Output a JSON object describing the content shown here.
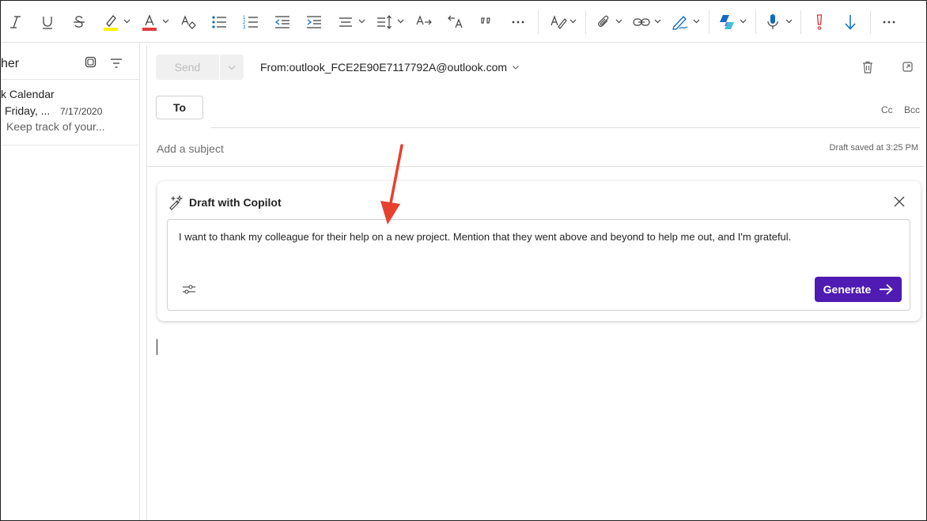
{
  "colors": {
    "accent": "#4f1bb3",
    "highlight_yellow": "#fff100",
    "font_red": "#e03c3c",
    "toolbar_blue": "#0f6cbd",
    "importance_red": "#d13438",
    "annotation_arrow": "#e8402e"
  },
  "toolbar": {
    "icons": [
      "italic-icon",
      "underline-icon",
      "strikethrough-icon",
      "highlight-icon",
      "font-color-icon",
      "clear-formatting-icon",
      "bullets-icon",
      "numbering-icon",
      "decrease-indent-icon",
      "increase-indent-icon",
      "align-icon",
      "line-spacing-icon",
      "text-direction-icon",
      "text-direction-rtl-icon",
      "quote-icon",
      "more-icon",
      "editor-icon",
      "attach-icon",
      "link-icon",
      "signature-icon",
      "copilot-icon",
      "dictate-icon",
      "importance-high-icon",
      "importance-low-icon",
      "more-icon"
    ]
  },
  "left_pane": {
    "folder_title": "her",
    "message": {
      "sender": "k Calendar",
      "subject": "Friday, ...",
      "date": "7/17/2020",
      "preview": "Keep track of your..."
    }
  },
  "compose": {
    "send_label": "Send",
    "from_label": "From:",
    "from_address": "outlook_FCE2E90E7117792A@outlook.com",
    "to_label": "To",
    "cc_label": "Cc",
    "bcc_label": "Bcc",
    "subject_placeholder": "Add a subject",
    "draft_status": "Draft saved at 3:25 PM"
  },
  "copilot": {
    "title": "Draft with Copilot",
    "prompt": "I want to thank my colleague for their help on a new project. Mention that they went above and beyond to help me out, and I'm grateful.",
    "generate_label": "Generate"
  }
}
